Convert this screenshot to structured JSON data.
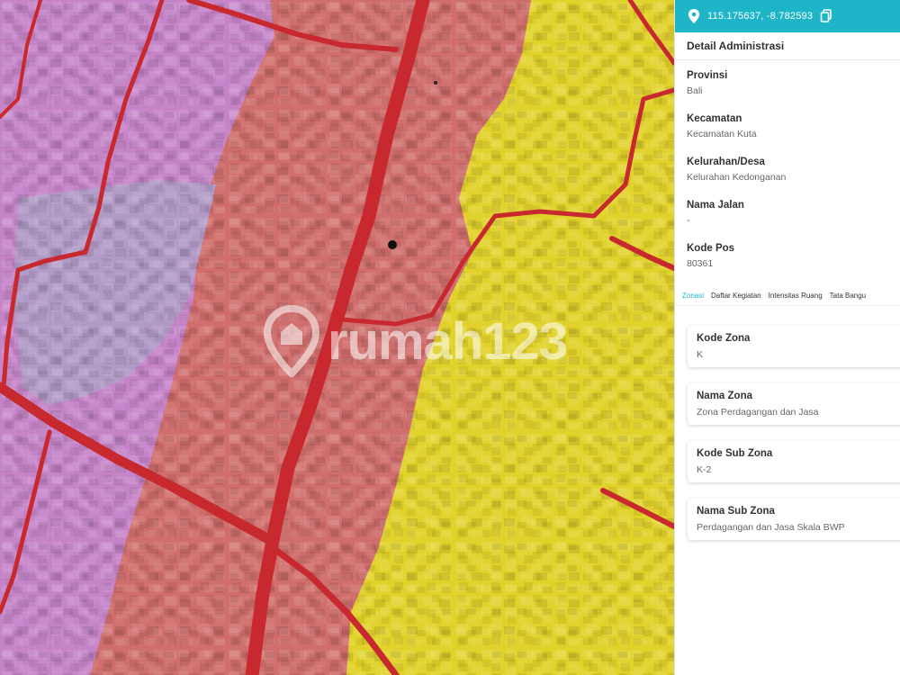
{
  "map": {
    "zone_colors": {
      "commercial": "#cf6e6c",
      "residential_low": "#e1d22b",
      "public_service": "#c584c8",
      "open_green": "#b19ac6",
      "road": "#c8292f"
    },
    "watermark": "rumah123"
  },
  "panel": {
    "coordinates": "115.175637, -8.782593",
    "accent_color": "#1fb5c9",
    "admin_title": "Detail Administrasi",
    "admin_fields": [
      {
        "label": "Provinsi",
        "value": "Bali"
      },
      {
        "label": "Kecamatan",
        "value": "Kecamatan Kuta"
      },
      {
        "label": "Kelurahan/Desa",
        "value": "Kelurahan Kedonganan"
      },
      {
        "label": "Nama Jalan",
        "value": "-"
      },
      {
        "label": "Kode Pos",
        "value": "80361"
      }
    ],
    "tabs": [
      "Zonasi",
      "Daftar Kegiatan",
      "Intensitas Ruang",
      "Tata Bangu"
    ],
    "zone_cards": [
      {
        "label": "Kode Zona",
        "value": "K"
      },
      {
        "label": "Nama Zona",
        "value": "Zona Perdagangan dan Jasa"
      },
      {
        "label": "Kode Sub Zona",
        "value": "K-2"
      },
      {
        "label": "Nama Sub Zona",
        "value": "Perdagangan dan Jasa Skala BWP"
      }
    ]
  }
}
